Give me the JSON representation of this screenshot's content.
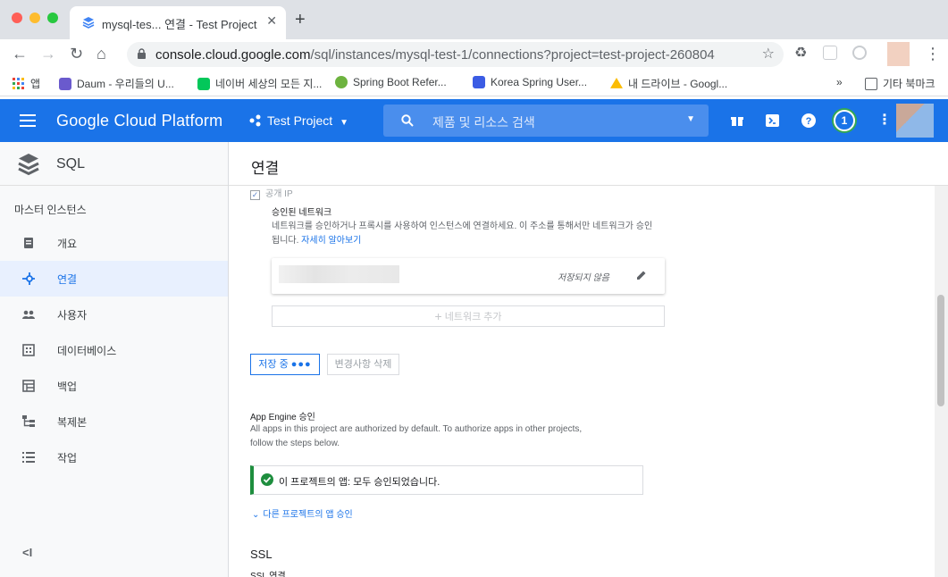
{
  "browser": {
    "tab_title": "mysql-tes... 연결 - Test Project",
    "url_host": "console.cloud.google.com",
    "url_path": "/sql/instances/mysql-test-1/connections?project=test-project-260804",
    "bookmarks": [
      {
        "label": "앱",
        "color": "#e8453c"
      },
      {
        "label": "Daum - 우리들의 U...",
        "color": "#6a5acd"
      },
      {
        "label": "네이버 세상의 모든 지...",
        "color": "#03c75a"
      },
      {
        "label": "Spring Boot Refer...",
        "color": "#6db33f"
      },
      {
        "label": "Korea Spring User...",
        "color": "#3b5ce4"
      },
      {
        "label": "내 드라이브 - Googl...",
        "color": "#fbbc04"
      }
    ],
    "bookmarks_more": "»",
    "other_bookmarks": "기타 북마크"
  },
  "header": {
    "brand": "Google Cloud Platform",
    "project": "Test Project",
    "search_placeholder": "제품 및 리소스 검색",
    "notification_count": "1",
    "accent": "#1a73e8"
  },
  "sidebar": {
    "product": "SQL",
    "section": "마스터 인스턴스",
    "items": [
      {
        "label": "개요",
        "icon": "overview-icon"
      },
      {
        "label": "연결",
        "icon": "connections-icon",
        "active": true
      },
      {
        "label": "사용자",
        "icon": "users-icon"
      },
      {
        "label": "데이터베이스",
        "icon": "databases-icon"
      },
      {
        "label": "백업",
        "icon": "backup-icon"
      },
      {
        "label": "복제본",
        "icon": "replicas-icon"
      },
      {
        "label": "작업",
        "icon": "operations-icon"
      }
    ],
    "collapse": "<I"
  },
  "main": {
    "title": "연결",
    "public_ip_label": "공개 IP",
    "authorized_networks_title": "승인된 네트워크",
    "authorized_networks_desc_1": "네트워크를 승인하거나 프록시를 사용하여 인스턴스에 연결하세요. 이 주소를 통해서만 네트워크가 승인",
    "authorized_networks_desc_2": "됩니다.",
    "learn_more": "자세히 알아보기",
    "network_status": "저장되지 않음",
    "add_network": "네트워크 추가",
    "saving_button": "저장 중",
    "discard_button": "변경사항 삭제",
    "app_engine_title": "App Engine 승인",
    "app_engine_desc_1": "All apps in this project are authorized by default. To authorize apps in other projects,",
    "app_engine_desc_2": "follow the steps below.",
    "app_engine_ok": "이 프로젝트의 앱: 모두 승인되었습니다.",
    "other_projects_link": "다른 프로젝트의 앱 승인",
    "ssl_title": "SSL",
    "ssl_sub": "SSL 연결"
  }
}
